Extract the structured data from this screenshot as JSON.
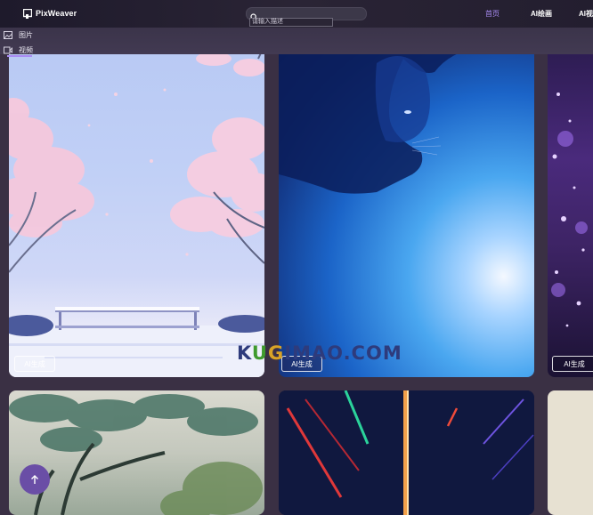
{
  "app": {
    "name": "PixWeaver"
  },
  "search": {
    "placeholder": "",
    "hint": "请输入描述"
  },
  "nav": {
    "home": "首页",
    "ai_draw": "AI绘画",
    "more": "AI视"
  },
  "type_switch": {
    "image": "图片",
    "video": "视频",
    "active": "video"
  },
  "gallery": {
    "badge_label": "AI生成",
    "cards": [
      {
        "subject": "cherry-blossom-bench",
        "badge": "AI生成"
      },
      {
        "subject": "blue-cat-silhouette",
        "badge": "AI生成"
      },
      {
        "subject": "purple-bokeh",
        "badge": "AI生成"
      },
      {
        "subject": "ink-tree-landscape"
      },
      {
        "subject": "neon-light-streaks"
      },
      {
        "subject": "beige-partial"
      }
    ]
  },
  "watermark": {
    "text_k": "K",
    "text_u": "U",
    "text_g": "G",
    "text_rest": "IMAO.COM"
  },
  "colors": {
    "accent": "#a98cf3",
    "header_bg": "#1e1a2b",
    "page_bg": "#3a3044",
    "back_to_top": "#6a4ea6"
  },
  "icons": {
    "logo": "pixweaver-logo-icon",
    "search": "search-icon",
    "image": "image-icon",
    "video": "video-icon",
    "back_to_top": "arrow-up-icon"
  }
}
